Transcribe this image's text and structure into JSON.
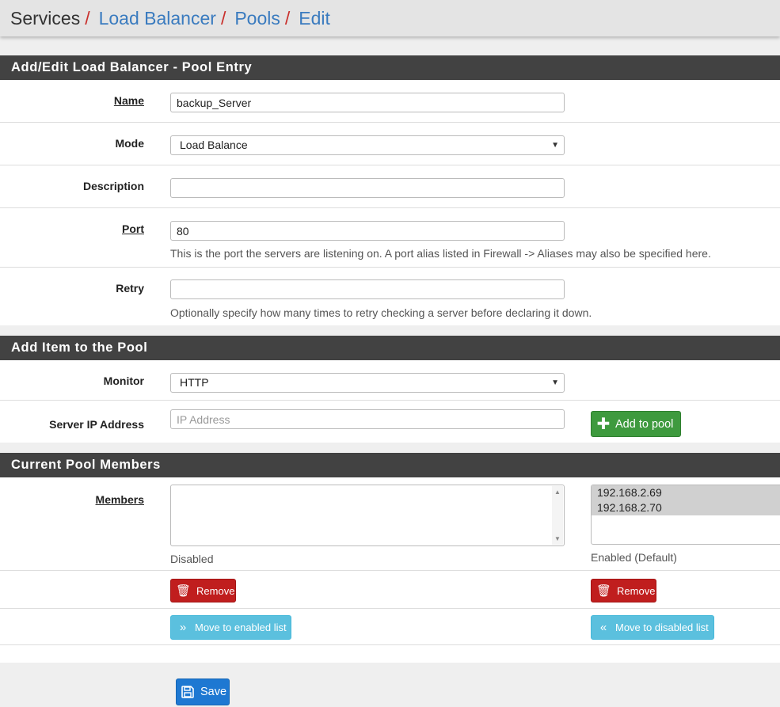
{
  "breadcrumb": {
    "items": [
      "Services",
      "Load Balancer",
      "Pools",
      "Edit"
    ],
    "separator": "/"
  },
  "pool_entry": {
    "heading": "Add/Edit Load Balancer - Pool Entry",
    "name": {
      "label": "Name",
      "value": "backup_Server"
    },
    "mode": {
      "label": "Mode",
      "value": "Load Balance"
    },
    "description": {
      "label": "Description",
      "value": ""
    },
    "port": {
      "label": "Port",
      "value": "80",
      "help": "This is the port the servers are listening on. A port alias listed in Firewall -> Aliases may also be specified here."
    },
    "retry": {
      "label": "Retry",
      "value": "",
      "help": "Optionally specify how many times to retry checking a server before declaring it down."
    }
  },
  "add_item": {
    "heading": "Add Item to the Pool",
    "monitor": {
      "label": "Monitor",
      "value": "HTTP"
    },
    "server_ip": {
      "label": "Server IP Address",
      "placeholder": "IP Address"
    },
    "add_button": "Add to pool"
  },
  "members": {
    "heading": "Current Pool Members",
    "label": "Members",
    "disabled_caption": "Disabled",
    "enabled_caption": "Enabled (Default)",
    "disabled_list": [],
    "enabled_list": [
      "192.168.2.69",
      "192.168.2.70"
    ],
    "remove_label": "Remove",
    "move_enabled_label": "Move to enabled list",
    "move_disabled_label": "Move to disabled list"
  },
  "save_label": "Save",
  "colors": {
    "accent_link": "#3a7bbf",
    "separator": "#c9302c",
    "heading_bg": "#424242",
    "success": "#3e9a3e",
    "danger": "#c01e1e",
    "info": "#5bc0de",
    "primary": "#1e78d2"
  }
}
